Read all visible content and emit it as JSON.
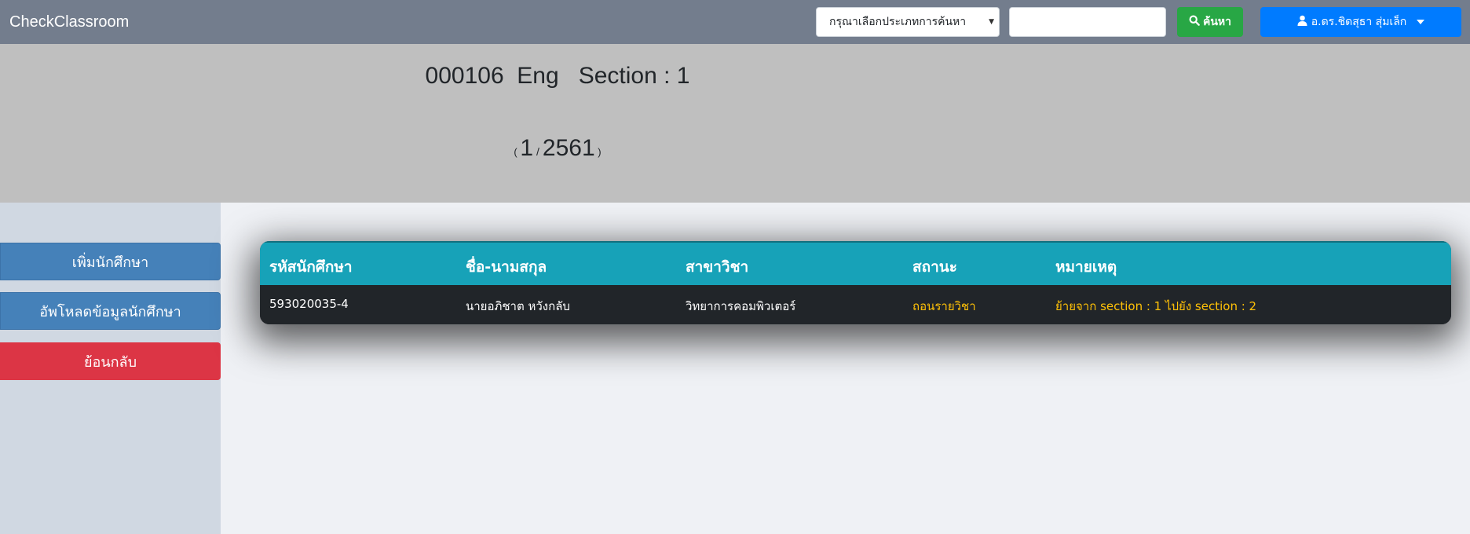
{
  "navbar": {
    "brand": "CheckClassroom",
    "search_type_selected": "กรุณาเลือกประเภทการค้นหา",
    "search_value": "",
    "search_button_label": "ค้นหา",
    "user_label": "อ.ดร.ชิดสุธา สุ่มเล็ก"
  },
  "course": {
    "code": "000106",
    "name": "Eng",
    "section_label": "Section : 1",
    "term": "1",
    "year": "2561"
  },
  "sidebar": {
    "add_student": "เพิ่มนักศึกษา",
    "upload_students": "อัพโหลดข้อมูลนักศึกษา",
    "back": "ย้อนกลับ"
  },
  "table": {
    "columns": [
      "รหัสนักศึกษา",
      "ชื่อ-นามสกุล",
      "สาขาวิชา",
      "สถานะ",
      "หมายเหตุ"
    ],
    "rows": [
      [
        "593020035-4",
        "นายอภิชาต หวังกลับ",
        "วิทยาการคอมพิวเตอร์",
        "ถอนรายวิชา",
        "ย้ายจาก section : 1 ไปยัง section : 2"
      ]
    ]
  },
  "colors": {
    "navbar": "#737d8d",
    "success": "#28a745",
    "primary": "#007bff",
    "danger": "#dc3545",
    "info": "#17a2b8",
    "dark": "#212529",
    "warning": "#ffc107"
  },
  "icons": {
    "search": "search-icon",
    "user": "user-icon",
    "dropdown": "caret-down-icon"
  }
}
